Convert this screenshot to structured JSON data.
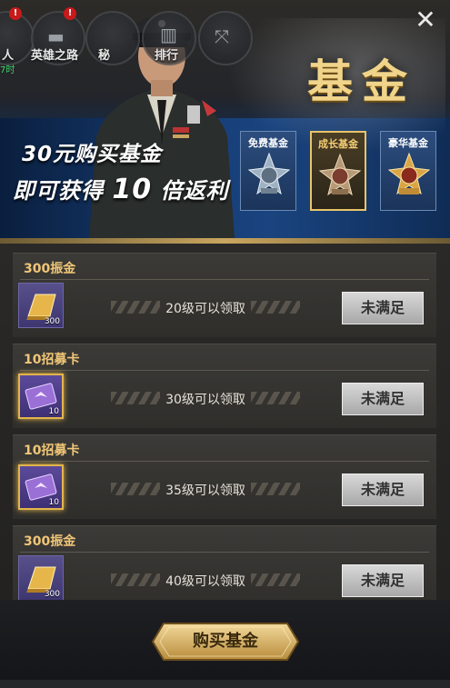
{
  "nav": {
    "items": [
      {
        "label": "人",
        "badge": "!",
        "sub": "7时"
      },
      {
        "label": "英雄之路",
        "badge": "!"
      },
      {
        "label": "秘",
        "badge": ""
      },
      {
        "label": "排行",
        "badge": ""
      },
      {
        "label": "",
        "badge": ""
      }
    ]
  },
  "header": {
    "title": "基金",
    "promo_line1": "30元购买基金",
    "promo_line2_pre": "即可获得",
    "promo_line2_num": "10",
    "promo_line2_post": "倍返利"
  },
  "tabs": [
    {
      "label": "免费基金",
      "active": false
    },
    {
      "label": "成长基金",
      "active": true
    },
    {
      "label": "豪华基金",
      "active": false
    }
  ],
  "rewards": [
    {
      "title": "300振金",
      "icon": "gold-bar-icon",
      "qty": "300",
      "condition": "20级可以领取",
      "button": "未满足"
    },
    {
      "title": "10招募卡",
      "icon": "recruit-card-icon",
      "qty": "10",
      "condition": "30级可以领取",
      "button": "未满足"
    },
    {
      "title": "10招募卡",
      "icon": "recruit-card-icon",
      "qty": "10",
      "condition": "35级可以领取",
      "button": "未满足"
    },
    {
      "title": "300振金",
      "icon": "gold-bar-icon",
      "qty": "300",
      "condition": "40级可以领取",
      "button": "未满足"
    }
  ],
  "footer": {
    "buy_label": "购买基金"
  },
  "colors": {
    "accent_gold": "#f0c677",
    "banner_blue": "#173e78",
    "button_gray": "#bdbdbd"
  }
}
